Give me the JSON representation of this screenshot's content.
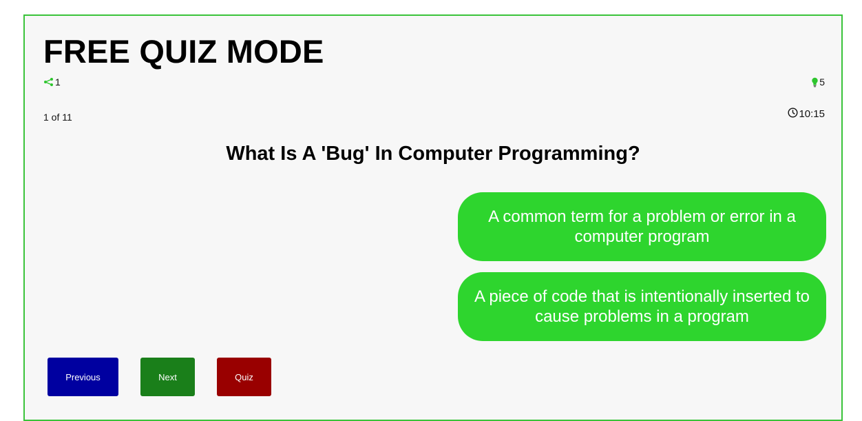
{
  "header": {
    "title": "FREE QUIZ MODE"
  },
  "stats": {
    "left_icon": "share-nodes-icon",
    "left_value": "1",
    "right_icon": "lightbulb-icon",
    "right_value": "5"
  },
  "progress": {
    "text": "1 of 11"
  },
  "timer": {
    "icon": "clock-icon",
    "value": "10:15"
  },
  "question": {
    "text": "What Is A 'Bug' In Computer Programming?"
  },
  "answers": [
    {
      "label": "A common term for a problem or error in a computer program"
    },
    {
      "label": "A piece of code that is intentionally inserted to cause problems in a program"
    }
  ],
  "nav": {
    "previous_label": "Previous",
    "next_label": "Next",
    "quiz_label": "Quiz"
  },
  "colors": {
    "frame_border": "#39c339",
    "answer_bg": "#2ed52e",
    "previous_bg": "#0000a0",
    "next_bg": "#1a7f1a",
    "quiz_bg": "#990000",
    "icon_green": "#2ec52e"
  }
}
